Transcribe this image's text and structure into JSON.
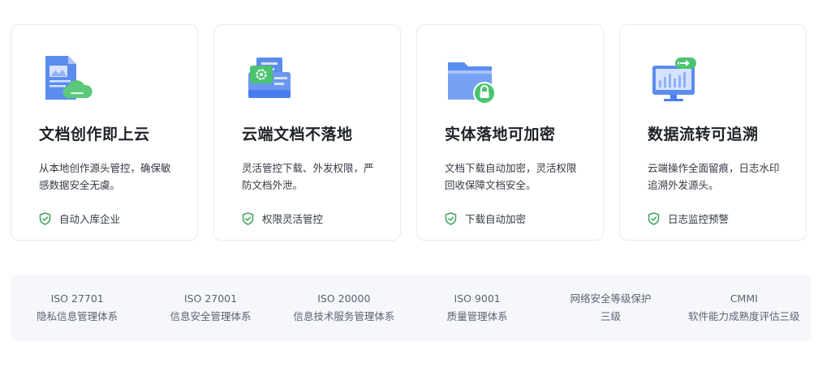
{
  "cards": [
    {
      "icon": "document-cloud-icon",
      "title": "文档创作即上云",
      "desc": "从本地创作源头管控，确保敏感数据安全无虞。",
      "tag": "自动入库企业"
    },
    {
      "icon": "cloud-document-settings-icon",
      "title": "云端文档不落地",
      "desc": "灵活管控下载、外发权限，严防文档外泄。",
      "tag": "权限灵活管控"
    },
    {
      "icon": "folder-lock-icon",
      "title": "实体落地可加密",
      "desc": "文档下载自动加密，灵活权限回收保障文档安全。",
      "tag": "下载自动加密"
    },
    {
      "icon": "monitor-transfer-icon",
      "title": "数据流转可追溯",
      "desc": "云端操作全面留痕，日志水印追溯外发源头。",
      "tag": "日志监控预警"
    }
  ],
  "certs": [
    {
      "line1": "ISO 27701",
      "line2": "隐私信息管理体系"
    },
    {
      "line1": "ISO 27001",
      "line2": "信息安全管理体系"
    },
    {
      "line1": "ISO 20000",
      "line2": "信息技术服务管理体系"
    },
    {
      "line1": "ISO 9001",
      "line2": "质量管理体系"
    },
    {
      "line1": "网络安全等级保护",
      "line2": "三级"
    },
    {
      "line1": "CMMI",
      "line2": "软件能力成熟度评估三级"
    }
  ],
  "colors": {
    "accent_blue": "#4a7df0",
    "accent_green": "#4cc46f",
    "check_green": "#3da35a"
  }
}
